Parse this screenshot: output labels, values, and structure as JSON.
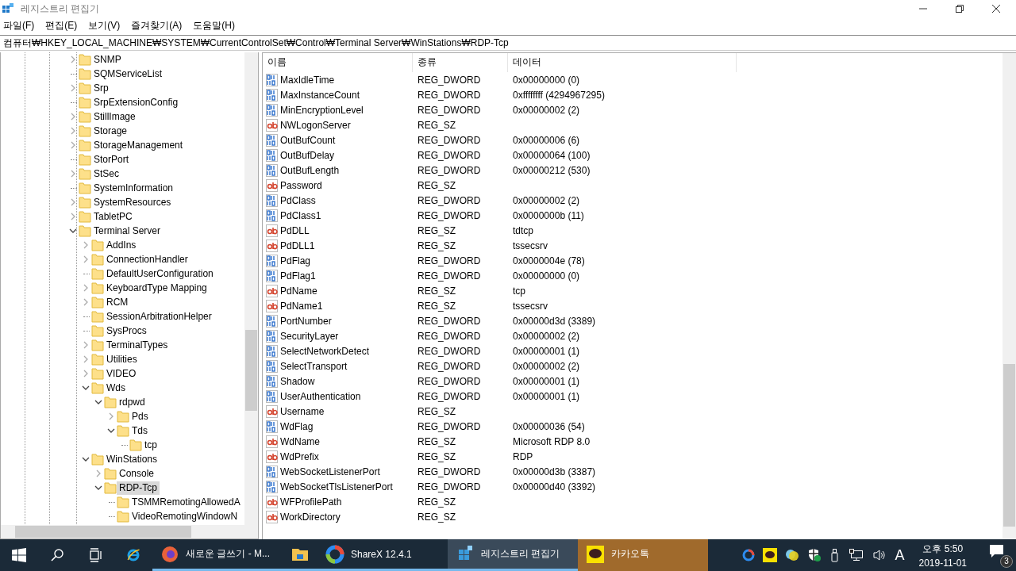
{
  "window": {
    "title": "레지스트리 편집기"
  },
  "menu": [
    "파일(F)",
    "편집(E)",
    "보기(V)",
    "즐겨찾기(A)",
    "도움말(H)"
  ],
  "address": "컴퓨터₩HKEY_LOCAL_MACHINE₩SYSTEM₩CurrentControlSet₩Control₩Terminal Server₩WinStations₩RDP-Tcp",
  "tree": [
    {
      "name": "SNMP",
      "kind": "branch",
      "expanded": false,
      "selected": false
    },
    {
      "name": "SQMServiceList",
      "kind": "leaf",
      "selected": false
    },
    {
      "name": "Srp",
      "kind": "branch",
      "expanded": false,
      "selected": false
    },
    {
      "name": "SrpExtensionConfig",
      "kind": "leaf",
      "selected": false
    },
    {
      "name": "StillImage",
      "kind": "branch",
      "expanded": false,
      "selected": false
    },
    {
      "name": "Storage",
      "kind": "branch",
      "expanded": false,
      "selected": false
    },
    {
      "name": "StorageManagement",
      "kind": "branch",
      "expanded": false,
      "selected": false
    },
    {
      "name": "StorPort",
      "kind": "leaf",
      "selected": false
    },
    {
      "name": "StSec",
      "kind": "branch",
      "expanded": false,
      "selected": false
    },
    {
      "name": "SystemInformation",
      "kind": "leaf",
      "selected": false
    },
    {
      "name": "SystemResources",
      "kind": "branch",
      "expanded": false,
      "selected": false
    },
    {
      "name": "TabletPC",
      "kind": "branch",
      "expanded": false,
      "selected": false
    },
    {
      "name": "Terminal Server",
      "kind": "branch",
      "expanded": true,
      "selected": false,
      "children": [
        {
          "name": "AddIns",
          "kind": "branch",
          "expanded": false,
          "selected": false
        },
        {
          "name": "ConnectionHandler",
          "kind": "branch",
          "expanded": false,
          "selected": false
        },
        {
          "name": "DefaultUserConfiguration",
          "kind": "leaf",
          "selected": false
        },
        {
          "name": "KeyboardType Mapping",
          "kind": "branch",
          "expanded": false,
          "selected": false
        },
        {
          "name": "RCM",
          "kind": "branch",
          "expanded": false,
          "selected": false
        },
        {
          "name": "SessionArbitrationHelper",
          "kind": "leaf",
          "selected": false
        },
        {
          "name": "SysProcs",
          "kind": "leaf",
          "selected": false
        },
        {
          "name": "TerminalTypes",
          "kind": "branch",
          "expanded": false,
          "selected": false
        },
        {
          "name": "Utilities",
          "kind": "branch",
          "expanded": false,
          "selected": false
        },
        {
          "name": "VIDEO",
          "kind": "branch",
          "expanded": false,
          "selected": false
        },
        {
          "name": "Wds",
          "kind": "branch",
          "expanded": true,
          "selected": false,
          "children": [
            {
              "name": "rdpwd",
              "kind": "branch",
              "expanded": true,
              "selected": false,
              "children": [
                {
                  "name": "Pds",
                  "kind": "branch",
                  "expanded": false,
                  "selected": false
                },
                {
                  "name": "Tds",
                  "kind": "branch",
                  "expanded": true,
                  "selected": false,
                  "children": [
                    {
                      "name": "tcp",
                      "kind": "leaf",
                      "selected": false
                    }
                  ]
                }
              ]
            }
          ]
        },
        {
          "name": "WinStations",
          "kind": "branch",
          "expanded": true,
          "selected": false,
          "children": [
            {
              "name": "Console",
              "kind": "branch",
              "expanded": false,
              "selected": false
            },
            {
              "name": "RDP-Tcp",
              "kind": "branch",
              "expanded": true,
              "selected": true,
              "children": [
                {
                  "name": "TSMMRemotingAllowedA",
                  "kind": "leaf",
                  "selected": false
                },
                {
                  "name": "VideoRemotingWindowN",
                  "kind": "leaf",
                  "selected": false
                }
              ]
            }
          ]
        }
      ]
    }
  ],
  "columns": [
    "이름",
    "종류",
    "데이터"
  ],
  "values": [
    {
      "kind": "binary",
      "name": "MaxIdleTime",
      "type": "REG_DWORD",
      "data": "0x00000000 (0)"
    },
    {
      "kind": "binary",
      "name": "MaxInstanceCount",
      "type": "REG_DWORD",
      "data": "0xffffffff (4294967295)"
    },
    {
      "kind": "binary",
      "name": "MinEncryptionLevel",
      "type": "REG_DWORD",
      "data": "0x00000002 (2)"
    },
    {
      "kind": "string",
      "name": "NWLogonServer",
      "type": "REG_SZ"
    },
    {
      "kind": "binary",
      "name": "OutBufCount",
      "type": "REG_DWORD",
      "data": "0x00000006 (6)"
    },
    {
      "kind": "binary",
      "name": "OutBufDelay",
      "type": "REG_DWORD",
      "data": "0x00000064 (100)"
    },
    {
      "kind": "binary",
      "name": "OutBufLength",
      "type": "REG_DWORD",
      "data": "0x00000212 (530)"
    },
    {
      "kind": "string",
      "name": "Password",
      "type": "REG_SZ"
    },
    {
      "kind": "binary",
      "name": "PdClass",
      "type": "REG_DWORD",
      "data": "0x00000002 (2)"
    },
    {
      "kind": "binary",
      "name": "PdClass1",
      "type": "REG_DWORD",
      "data": "0x0000000b (11)"
    },
    {
      "kind": "string",
      "name": "PdDLL",
      "type": "REG_SZ",
      "data": "tdtcp"
    },
    {
      "kind": "string",
      "name": "PdDLL1",
      "type": "REG_SZ",
      "data": "tssecsrv"
    },
    {
      "kind": "binary",
      "name": "PdFlag",
      "type": "REG_DWORD",
      "data": "0x0000004e (78)"
    },
    {
      "kind": "binary",
      "name": "PdFlag1",
      "type": "REG_DWORD",
      "data": "0x00000000 (0)"
    },
    {
      "kind": "string",
      "name": "PdName",
      "type": "REG_SZ",
      "data": "tcp"
    },
    {
      "kind": "string",
      "name": "PdName1",
      "type": "REG_SZ",
      "data": "tssecsrv"
    },
    {
      "kind": "binary",
      "name": "PortNumber",
      "type": "REG_DWORD",
      "data": "0x00000d3d (3389)"
    },
    {
      "kind": "binary",
      "name": "SecurityLayer",
      "type": "REG_DWORD",
      "data": "0x00000002 (2)"
    },
    {
      "kind": "binary",
      "name": "SelectNetworkDetect",
      "type": "REG_DWORD",
      "data": "0x00000001 (1)"
    },
    {
      "kind": "binary",
      "name": "SelectTransport",
      "type": "REG_DWORD",
      "data": "0x00000002 (2)"
    },
    {
      "kind": "binary",
      "name": "Shadow",
      "type": "REG_DWORD",
      "data": "0x00000001 (1)"
    },
    {
      "kind": "binary",
      "name": "UserAuthentication",
      "type": "REG_DWORD",
      "data": "0x00000001 (1)"
    },
    {
      "kind": "string",
      "name": "Username",
      "type": "REG_SZ"
    },
    {
      "kind": "binary",
      "name": "WdFlag",
      "type": "REG_DWORD",
      "data": "0x00000036 (54)"
    },
    {
      "kind": "string",
      "name": "WdName",
      "type": "REG_SZ",
      "data": "Microsoft RDP 8.0"
    },
    {
      "kind": "string",
      "name": "WdPrefix",
      "type": "REG_SZ",
      "data": "RDP"
    },
    {
      "kind": "binary",
      "name": "WebSocketListenerPort",
      "type": "REG_DWORD",
      "data": "0x00000d3b (3387)"
    },
    {
      "kind": "binary",
      "name": "WebSocketTlsListenerPort",
      "type": "REG_DWORD",
      "data": "0x00000d40 (3392)"
    },
    {
      "kind": "string",
      "name": "WFProfilePath",
      "type": "REG_SZ"
    },
    {
      "kind": "string",
      "name": "WorkDirectory",
      "type": "REG_SZ"
    }
  ],
  "taskbar": {
    "apps": [
      {
        "kind": "firefox",
        "label": "새로운 글쓰기 - M...",
        "selected": false,
        "flashing": false
      },
      {
        "kind": "explorer",
        "selected": false,
        "flashing": false
      },
      {
        "kind": "sharex",
        "label": "ShareX 12.4.1",
        "selected": false,
        "flashing": false
      },
      {
        "kind": "regedit",
        "label": "레지스트리 편집기",
        "selected": true,
        "flashing": false
      },
      {
        "kind": "kakao",
        "label": "카카오톡",
        "selected": false,
        "flashing": true
      }
    ],
    "ime": "A",
    "time": "오후 5:50",
    "date": "2019-11-01",
    "notifications": "3"
  }
}
